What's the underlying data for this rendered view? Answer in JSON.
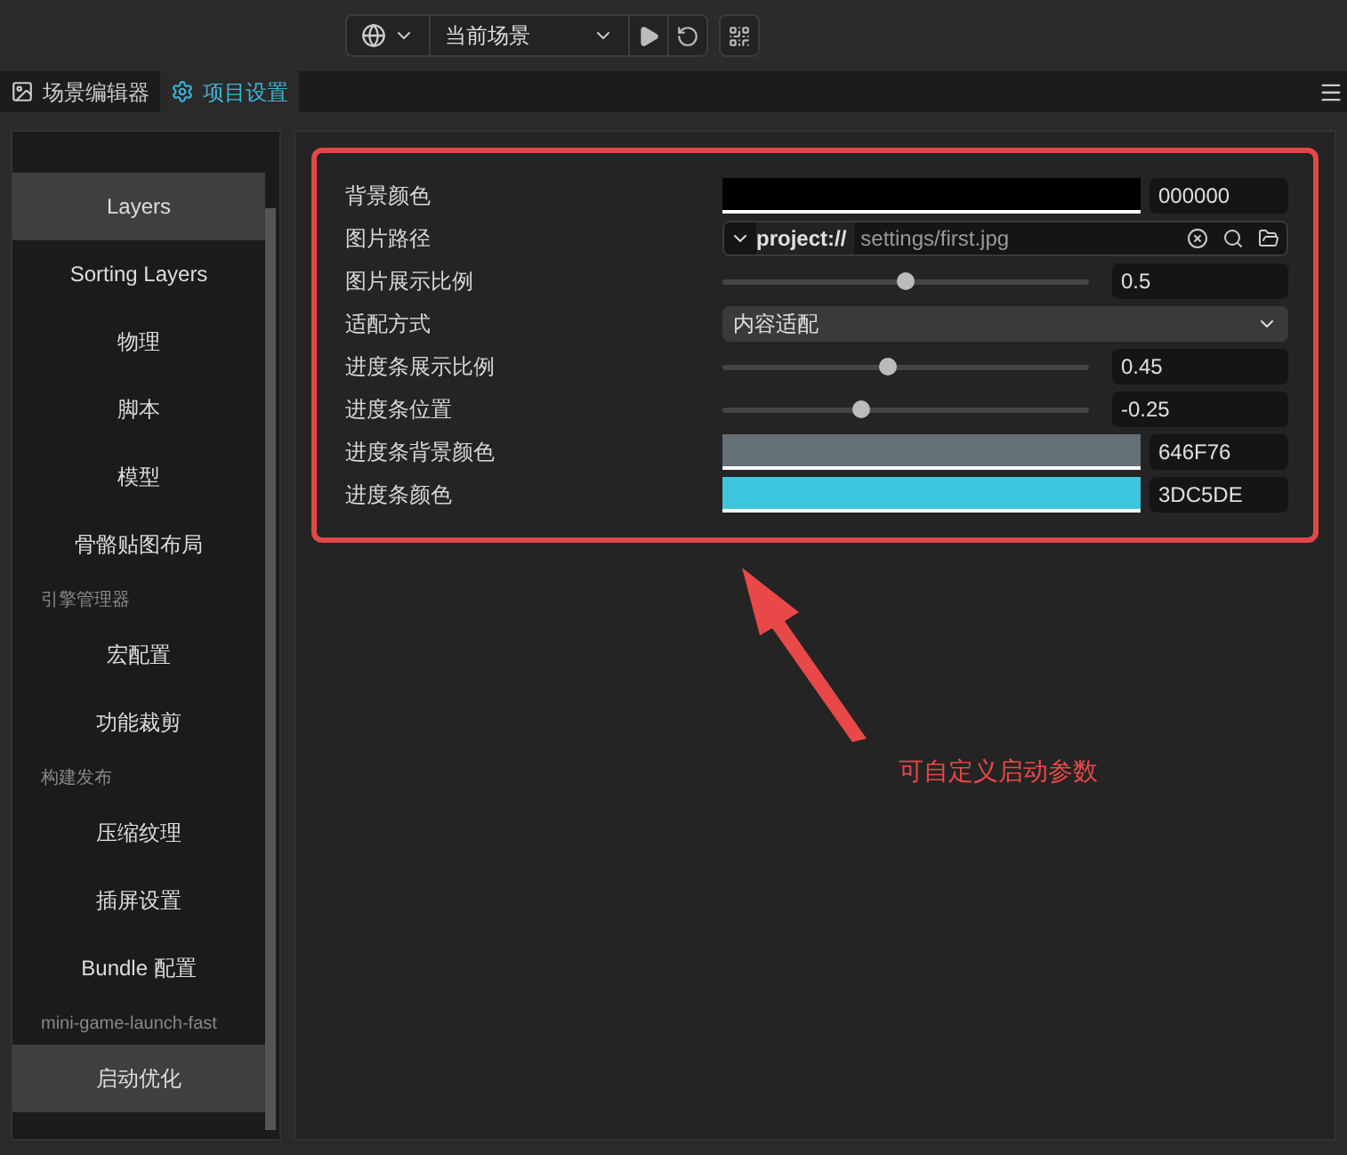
{
  "toolbar": {
    "scene_select": "当前场景"
  },
  "tabs": [
    {
      "label": "场景编辑器",
      "selected": false
    },
    {
      "label": "项目设置",
      "selected": true
    }
  ],
  "sidebar": {
    "items": [
      {
        "kind": "item",
        "label": "Layers",
        "selected": true
      },
      {
        "kind": "item",
        "label": "Sorting Layers",
        "selected": false
      },
      {
        "kind": "item",
        "label": "物理",
        "selected": false
      },
      {
        "kind": "item",
        "label": "脚本",
        "selected": false
      },
      {
        "kind": "item",
        "label": "模型",
        "selected": false
      },
      {
        "kind": "item",
        "label": "骨骼贴图布局",
        "selected": false
      },
      {
        "kind": "header",
        "label": "引擎管理器"
      },
      {
        "kind": "item",
        "label": "宏配置",
        "selected": false
      },
      {
        "kind": "item",
        "label": "功能裁剪",
        "selected": false
      },
      {
        "kind": "header",
        "label": "构建发布"
      },
      {
        "kind": "item",
        "label": "压缩纹理",
        "selected": false
      },
      {
        "kind": "item",
        "label": "插屏设置",
        "selected": false
      },
      {
        "kind": "item",
        "label": "Bundle 配置",
        "selected": false
      },
      {
        "kind": "header",
        "label": "mini-game-launch-fast"
      },
      {
        "kind": "item",
        "label": "启动优化",
        "selected": true
      }
    ]
  },
  "settings": [
    {
      "kind": "color",
      "label": "背景颜色",
      "color": "#000000",
      "value": "000000"
    },
    {
      "kind": "asset",
      "label": "图片路径",
      "protocol": "project://",
      "value": "settings/first.jpg"
    },
    {
      "kind": "slider",
      "label": "图片展示比例",
      "level": 0.5,
      "value": "0.5"
    },
    {
      "kind": "select",
      "label": "适配方式",
      "value": "内容适配"
    },
    {
      "kind": "slider",
      "label": "进度条展示比例",
      "level": 0.45,
      "value": "0.45"
    },
    {
      "kind": "slider",
      "label": "进度条位置",
      "level": 0.38,
      "value": "-0.25"
    },
    {
      "kind": "color",
      "label": "进度条背景颜色",
      "color": "#646f76",
      "value": "646F76"
    },
    {
      "kind": "color",
      "label": "进度条颜色",
      "color": "#3dc5de",
      "value": "3DC5DE"
    }
  ],
  "annotation": "可自定义启动参数"
}
